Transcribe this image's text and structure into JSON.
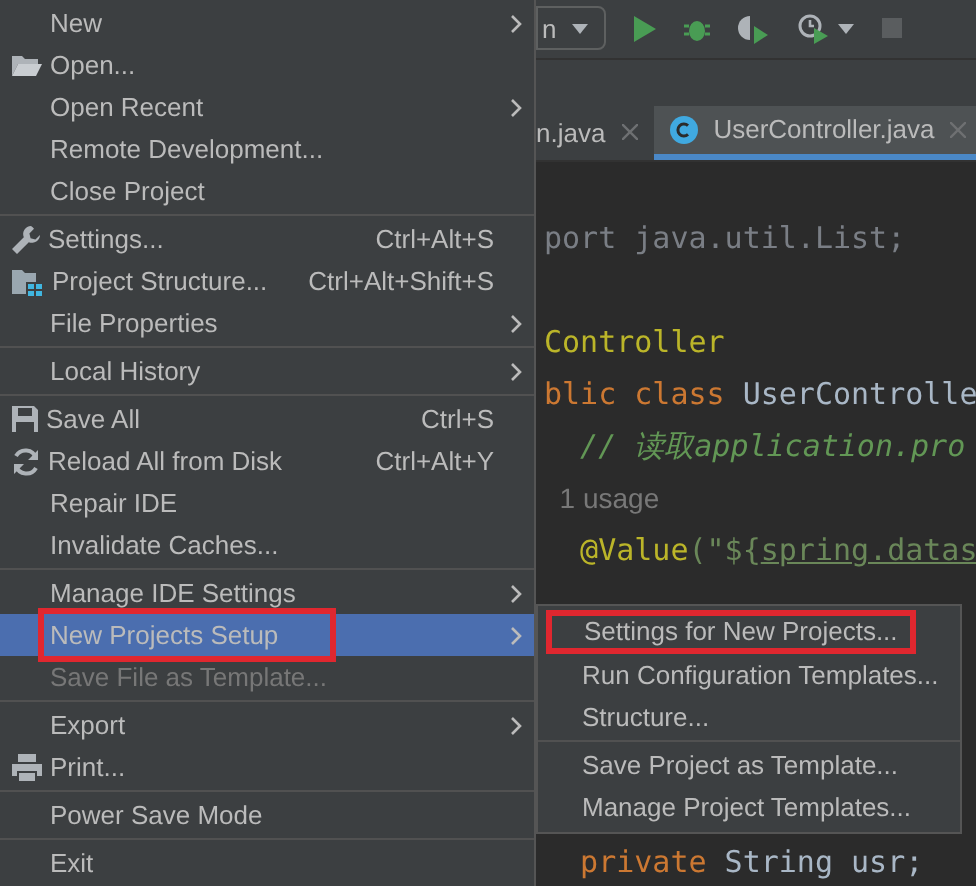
{
  "toolbar": {
    "run_config": "n"
  },
  "tabs": [
    {
      "label": "n.java",
      "selected": false
    },
    {
      "label": "UserController.java",
      "selected": true
    }
  ],
  "code": [
    {
      "kind": "blank"
    },
    {
      "kind": "code",
      "segments": [
        {
          "text": "port java.util.List;",
          "kind": "unused"
        }
      ]
    },
    {
      "kind": "blank"
    },
    {
      "kind": "code",
      "segments": [
        {
          "text": "Controller",
          "kind": "annotation"
        }
      ]
    },
    {
      "kind": "code",
      "segments": [
        {
          "text": "blic",
          "kind": "keyword"
        },
        {
          "text": " class",
          "kind": "keyword"
        },
        {
          "text": " UserControlle",
          "kind": "plain"
        }
      ]
    },
    {
      "kind": "code",
      "segments": [
        {
          "text": "  // 读取application.pro",
          "kind": "comment"
        }
      ]
    },
    {
      "kind": "hint",
      "segments": [
        {
          "text": "  1 usage",
          "kind": "hint"
        }
      ]
    },
    {
      "kind": "code",
      "segments": [
        {
          "text": "  @Value",
          "kind": "annotation"
        },
        {
          "text": "(\"${",
          "kind": "string"
        },
        {
          "text": "spring.datas",
          "kind": "link"
        }
      ]
    },
    {
      "kind": "blank"
    },
    {
      "kind": "blank"
    },
    {
      "kind": "blank"
    },
    {
      "kind": "blank"
    },
    {
      "kind": "blank"
    },
    {
      "kind": "code",
      "segments": [
        {
          "text": "  private",
          "kind": "keyword"
        },
        {
          "text": " String usr;",
          "kind": "plain"
        }
      ]
    }
  ],
  "menu": {
    "groups": [
      [
        {
          "label": "New",
          "kind": "plain",
          "submenu": true,
          "selected": false,
          "disabled": false,
          "annotated": false
        },
        {
          "label": "Open...",
          "kind": "folder",
          "submenu": false,
          "selected": false,
          "disabled": false,
          "annotated": false
        },
        {
          "label": "Open Recent",
          "kind": "plain",
          "submenu": true,
          "selected": false,
          "disabled": false,
          "annotated": false
        },
        {
          "label": "Remote Development...",
          "kind": "plain",
          "submenu": false,
          "selected": false,
          "disabled": false,
          "annotated": false
        },
        {
          "label": "Close Project",
          "kind": "plain",
          "submenu": false,
          "selected": false,
          "disabled": false,
          "annotated": false
        }
      ],
      [
        {
          "label": "Settings...",
          "kind": "wrench",
          "shortcut": "Ctrl+Alt+S",
          "submenu": false,
          "selected": false,
          "disabled": false,
          "annotated": false
        },
        {
          "label": "Project Structure...",
          "kind": "structure",
          "shortcut": "Ctrl+Alt+Shift+S",
          "submenu": false,
          "selected": false,
          "disabled": false,
          "annotated": false
        },
        {
          "label": "File Properties",
          "kind": "plain",
          "submenu": true,
          "selected": false,
          "disabled": false,
          "annotated": false
        }
      ],
      [
        {
          "label": "Local History",
          "kind": "plain",
          "submenu": true,
          "selected": false,
          "disabled": false,
          "annotated": false
        }
      ],
      [
        {
          "label": "Save All",
          "kind": "save",
          "shortcut": "Ctrl+S",
          "submenu": false,
          "selected": false,
          "disabled": false,
          "annotated": false
        },
        {
          "label": "Reload All from Disk",
          "kind": "reload",
          "shortcut": "Ctrl+Alt+Y",
          "submenu": false,
          "selected": false,
          "disabled": false,
          "annotated": false
        },
        {
          "label": "Repair IDE",
          "kind": "plain",
          "submenu": false,
          "selected": false,
          "disabled": false,
          "annotated": false
        },
        {
          "label": "Invalidate Caches...",
          "kind": "plain",
          "submenu": false,
          "selected": false,
          "disabled": false,
          "annotated": false
        }
      ],
      [
        {
          "label": "Manage IDE Settings",
          "kind": "plain",
          "submenu": true,
          "selected": false,
          "disabled": false,
          "annotated": false
        },
        {
          "label": "New Projects Setup",
          "kind": "plain",
          "submenu": true,
          "selected": true,
          "disabled": false,
          "annotated": true
        },
        {
          "label": "Save File as Template...",
          "kind": "plain",
          "submenu": false,
          "selected": false,
          "disabled": true,
          "annotated": false
        }
      ],
      [
        {
          "label": "Export",
          "kind": "plain",
          "submenu": true,
          "selected": false,
          "disabled": false,
          "annotated": false
        },
        {
          "label": "Print...",
          "kind": "printer",
          "submenu": false,
          "selected": false,
          "disabled": false,
          "annotated": false
        }
      ],
      [
        {
          "label": "Power Save Mode",
          "kind": "plain",
          "submenu": false,
          "selected": false,
          "disabled": false,
          "annotated": false
        }
      ],
      [
        {
          "label": "Exit",
          "kind": "plain",
          "submenu": false,
          "selected": false,
          "disabled": false,
          "annotated": false
        }
      ]
    ]
  },
  "submenu": {
    "groups": [
      [
        {
          "label": "Settings for New Projects...",
          "annotated": true
        },
        {
          "label": "Run Configuration Templates...",
          "annotated": false
        },
        {
          "label": "Structure...",
          "annotated": false
        }
      ],
      [
        {
          "label": "Save Project as Template...",
          "annotated": false
        },
        {
          "label": "Manage Project Templates...",
          "annotated": false
        }
      ]
    ]
  }
}
